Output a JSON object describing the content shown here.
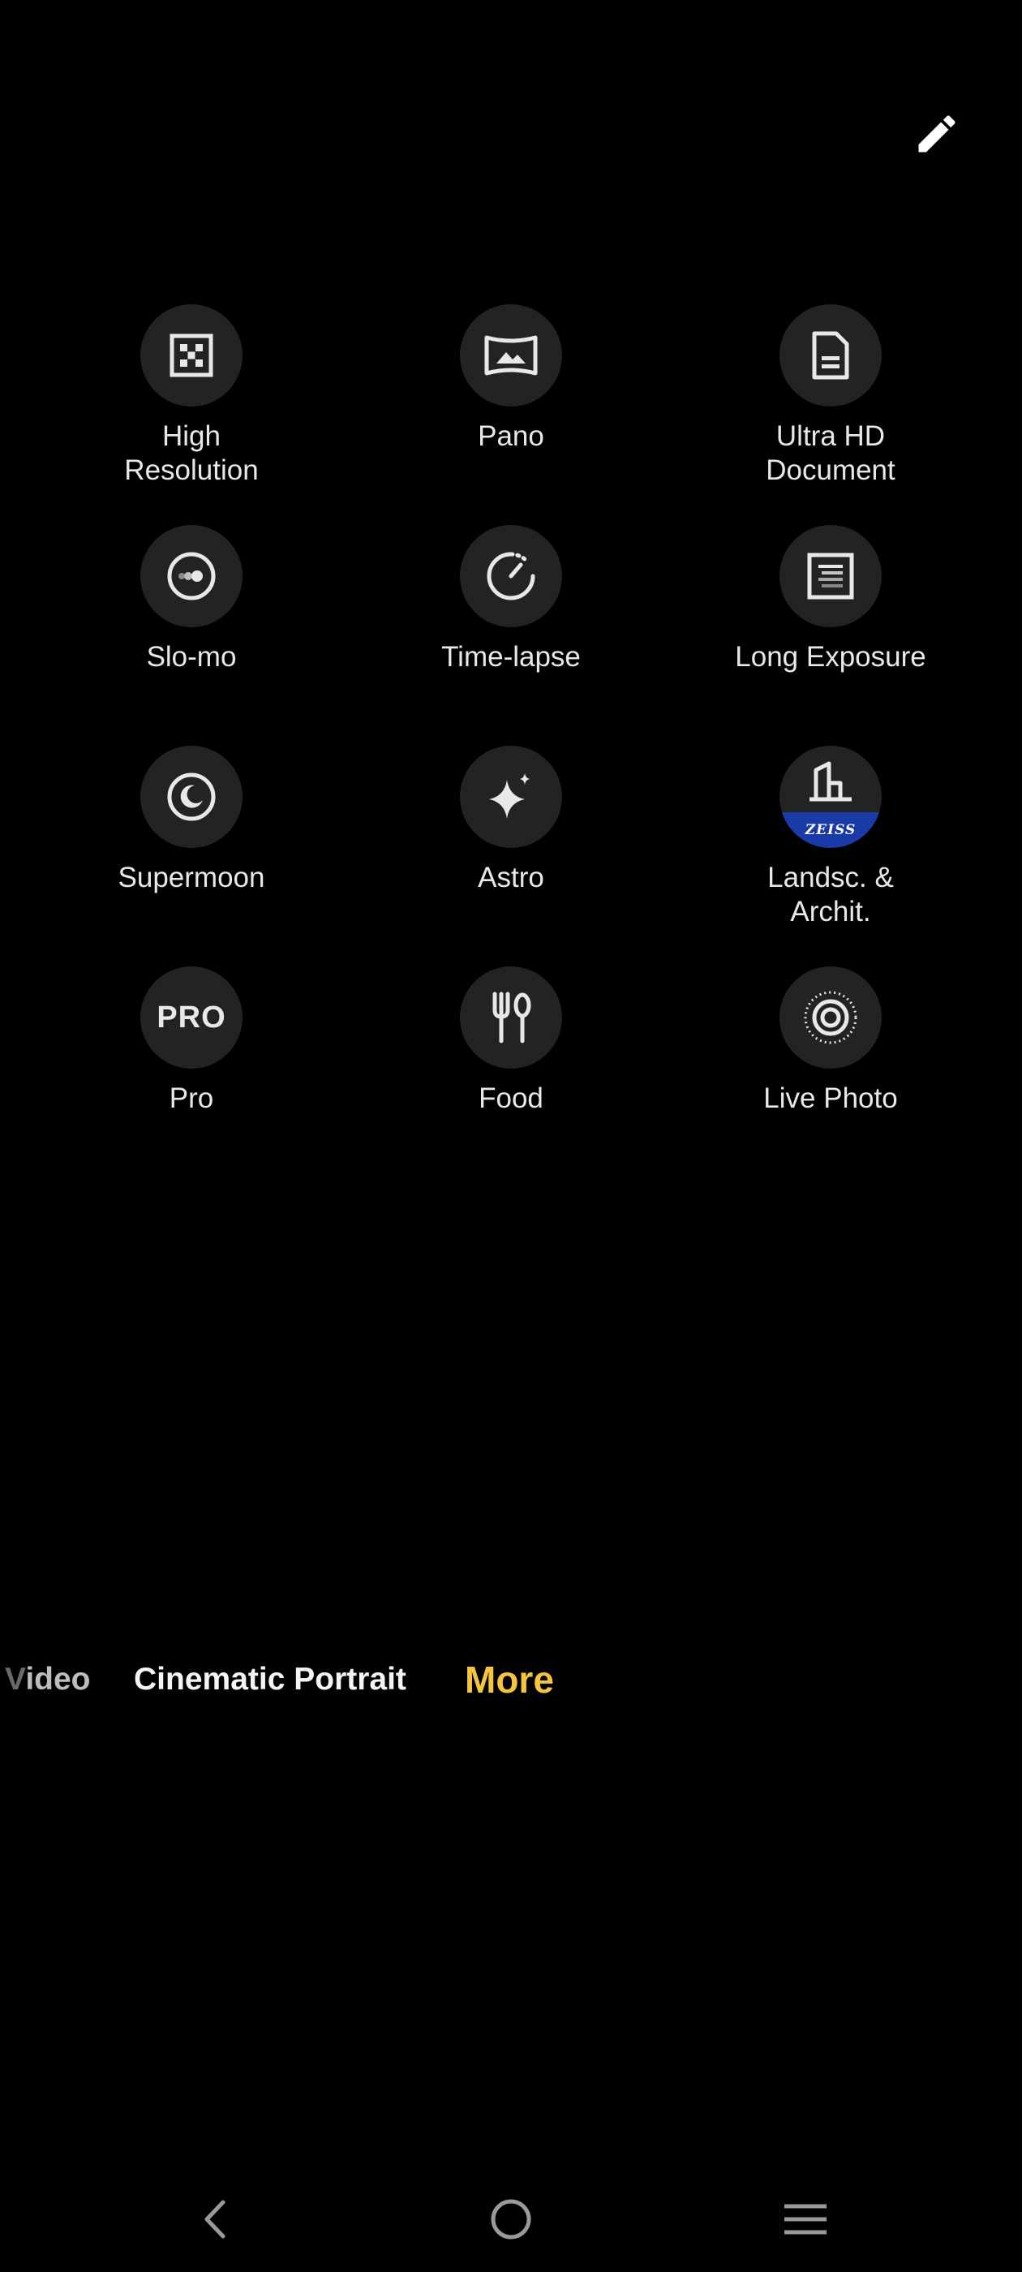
{
  "header": {
    "edit_icon": "pencil-icon"
  },
  "modes": [
    {
      "id": "high-resolution",
      "label": "High\nResolution",
      "icon": "high-resolution-icon"
    },
    {
      "id": "pano",
      "label": "Pano",
      "icon": "pano-icon"
    },
    {
      "id": "ultra-hd-document",
      "label": "Ultra HD\nDocument",
      "icon": "document-icon"
    },
    {
      "id": "slo-mo",
      "label": "Slo-mo",
      "icon": "slo-mo-icon"
    },
    {
      "id": "time-lapse",
      "label": "Time-lapse",
      "icon": "time-lapse-icon"
    },
    {
      "id": "long-exposure",
      "label": "Long Exposure",
      "icon": "long-exposure-icon"
    },
    {
      "id": "supermoon",
      "label": "Supermoon",
      "icon": "moon-icon"
    },
    {
      "id": "astro",
      "label": "Astro",
      "icon": "sparkle-icon"
    },
    {
      "id": "landscape-architecture",
      "label": "Landsc. &\nArchit.",
      "icon": "building-icon",
      "badge": "ZEISS"
    },
    {
      "id": "pro",
      "label": "Pro",
      "icon": "pro-icon",
      "icon_text": "PRO"
    },
    {
      "id": "food",
      "label": "Food",
      "icon": "fork-spoon-icon"
    },
    {
      "id": "live-photo",
      "label": "Live Photo",
      "icon": "live-photo-icon"
    }
  ],
  "mode_bar": {
    "video_prefix": "V",
    "video_rest": "ideo",
    "cinematic": "Cinematic Portrait",
    "more": "More",
    "active_color": "#f4c53d"
  },
  "nav": {
    "back_icon": "back-chevron-icon",
    "home_icon": "home-circle-icon",
    "menu_icon": "menu-lines-icon"
  }
}
